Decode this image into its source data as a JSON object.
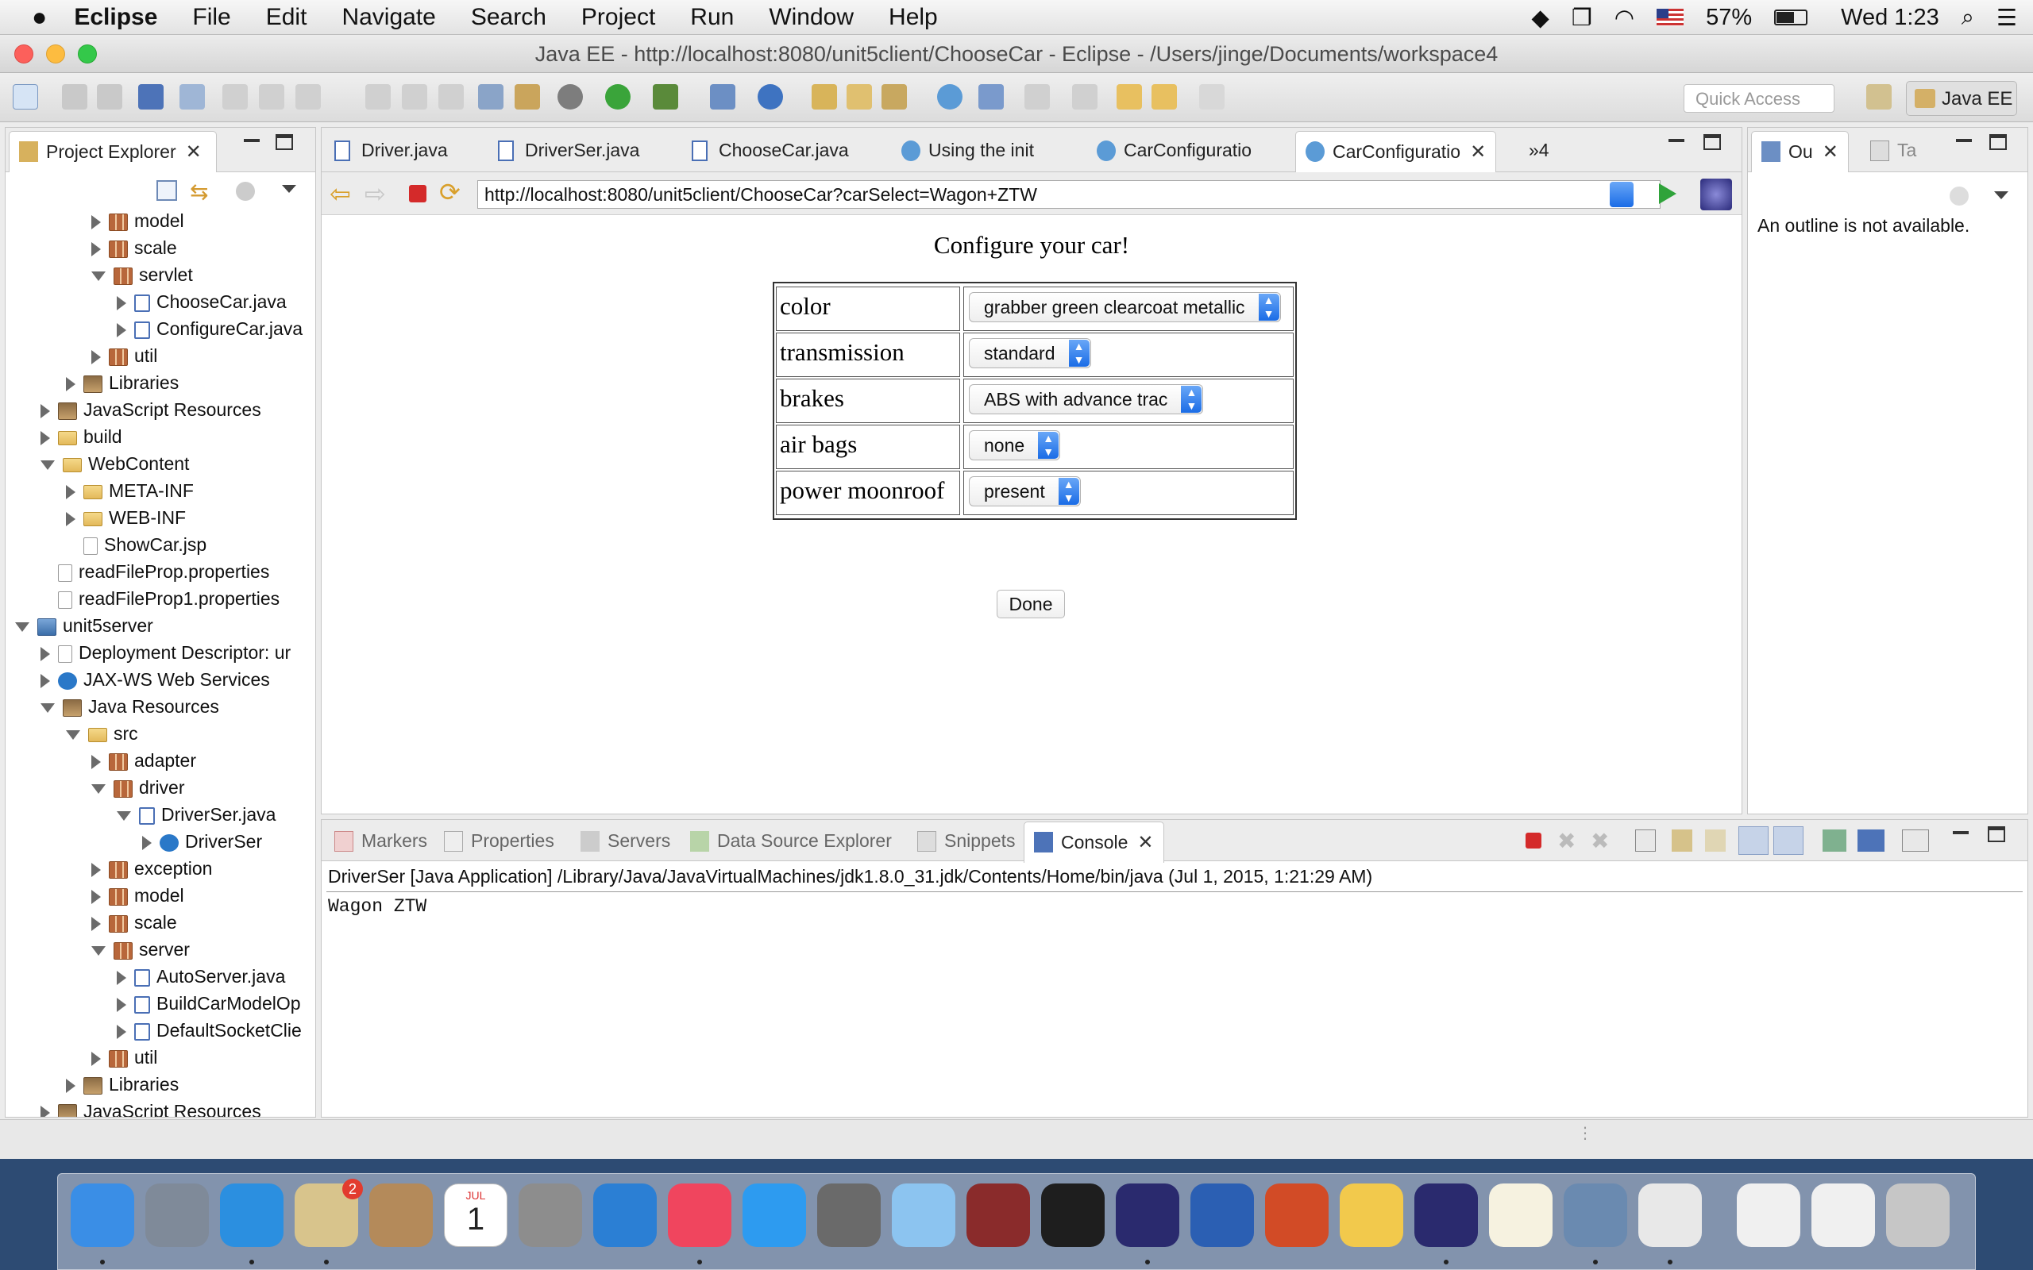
{
  "menubar": {
    "app": "Eclipse",
    "items": [
      "File",
      "Edit",
      "Navigate",
      "Search",
      "Project",
      "Run",
      "Window",
      "Help"
    ],
    "battery": "57%",
    "clock": "Wed 1:23"
  },
  "window": {
    "title": "Java EE - http://localhost:8080/unit5client/ChooseCar - Eclipse - /Users/jinge/Documents/workspace4",
    "quick_access_placeholder": "Quick Access",
    "perspective": "Java EE"
  },
  "project_explorer": {
    "tab_label": "Project Explorer",
    "rows": [
      {
        "depth": 4,
        "twisty": "r",
        "icon": "pkg",
        "label": "model"
      },
      {
        "depth": 4,
        "twisty": "r",
        "icon": "pkg",
        "label": "scale"
      },
      {
        "depth": 4,
        "twisty": "d",
        "icon": "pkg",
        "label": "servlet"
      },
      {
        "depth": 5,
        "twisty": "r",
        "icon": "java",
        "label": "ChooseCar.java"
      },
      {
        "depth": 5,
        "twisty": "r",
        "icon": "java",
        "label": "ConfigureCar.java"
      },
      {
        "depth": 4,
        "twisty": "r",
        "icon": "pkg",
        "label": "util"
      },
      {
        "depth": 3,
        "twisty": "r",
        "icon": "lib",
        "label": "Libraries"
      },
      {
        "depth": 2,
        "twisty": "r",
        "icon": "lib",
        "label": "JavaScript Resources"
      },
      {
        "depth": 2,
        "twisty": "r",
        "icon": "folder",
        "label": "build"
      },
      {
        "depth": 2,
        "twisty": "d",
        "icon": "folder",
        "label": "WebContent"
      },
      {
        "depth": 3,
        "twisty": "r",
        "icon": "folder",
        "label": "META-INF"
      },
      {
        "depth": 3,
        "twisty": "r",
        "icon": "folder",
        "label": "WEB-INF"
      },
      {
        "depth": 3,
        "twisty": "n",
        "icon": "file",
        "label": "ShowCar.jsp"
      },
      {
        "depth": 2,
        "twisty": "n",
        "icon": "file",
        "label": "readFileProp.properties"
      },
      {
        "depth": 2,
        "twisty": "n",
        "icon": "file",
        "label": "readFileProp1.properties"
      },
      {
        "depth": 1,
        "twisty": "d",
        "icon": "proj",
        "label": "unit5server"
      },
      {
        "depth": 2,
        "twisty": "r",
        "icon": "file",
        "label": "Deployment Descriptor: ur"
      },
      {
        "depth": 2,
        "twisty": "r",
        "icon": "ws",
        "label": "JAX-WS Web Services"
      },
      {
        "depth": 2,
        "twisty": "d",
        "icon": "lib",
        "label": "Java Resources"
      },
      {
        "depth": 3,
        "twisty": "d",
        "icon": "folder",
        "label": "src"
      },
      {
        "depth": 4,
        "twisty": "r",
        "icon": "pkg",
        "label": "adapter"
      },
      {
        "depth": 4,
        "twisty": "d",
        "icon": "pkg",
        "label": "driver"
      },
      {
        "depth": 5,
        "twisty": "d",
        "icon": "java",
        "label": "DriverSer.java"
      },
      {
        "depth": 6,
        "twisty": "r",
        "icon": "ws",
        "label": "DriverSer"
      },
      {
        "depth": 4,
        "twisty": "r",
        "icon": "pkg",
        "label": "exception"
      },
      {
        "depth": 4,
        "twisty": "r",
        "icon": "pkg",
        "label": "model"
      },
      {
        "depth": 4,
        "twisty": "r",
        "icon": "pkg",
        "label": "scale"
      },
      {
        "depth": 4,
        "twisty": "d",
        "icon": "pkg",
        "label": "server"
      },
      {
        "depth": 5,
        "twisty": "r",
        "icon": "java",
        "label": "AutoServer.java"
      },
      {
        "depth": 5,
        "twisty": "r",
        "icon": "java",
        "label": "BuildCarModelOp"
      },
      {
        "depth": 5,
        "twisty": "r",
        "icon": "java",
        "label": "DefaultSocketClie"
      },
      {
        "depth": 4,
        "twisty": "r",
        "icon": "pkg",
        "label": "util"
      },
      {
        "depth": 3,
        "twisty": "r",
        "icon": "lib",
        "label": "Libraries"
      },
      {
        "depth": 2,
        "twisty": "r",
        "icon": "lib",
        "label": "JavaScript Resources"
      }
    ]
  },
  "editor": {
    "tabs": [
      "Driver.java",
      "DriverSer.java",
      "ChooseCar.java",
      "Using the init",
      "CarConfiguratio",
      "CarConfiguratio"
    ],
    "overflow": "»4",
    "url": "http://localhost:8080/unit5client/ChooseCar?carSelect=Wagon+ZTW",
    "page": {
      "title": "Configure your car!",
      "options": [
        {
          "label": "color",
          "value": "grabber green clearcoat metallic"
        },
        {
          "label": "transmission",
          "value": "standard"
        },
        {
          "label": "brakes",
          "value": "ABS with advance trac"
        },
        {
          "label": "air bags",
          "value": "none"
        },
        {
          "label": "power moonroof",
          "value": "present"
        }
      ],
      "done": "Done"
    }
  },
  "outline": {
    "tab1": "Ou",
    "tab2": "Ta",
    "message": "An outline is not available."
  },
  "bottom": {
    "tabs": [
      "Markers",
      "Properties",
      "Servers",
      "Data Source Explorer",
      "Snippets",
      "Console"
    ],
    "console_header": "DriverSer [Java Application] /Library/Java/JavaVirtualMachines/jdk1.8.0_31.jdk/Contents/Home/bin/java (Jul 1, 2015, 1:21:29 AM)",
    "console_output": "Wagon ZTW"
  },
  "dock": {
    "items": [
      "finder-icon",
      "launchpad-icon",
      "safari-icon",
      "mail-icon",
      "contacts-icon",
      "calendar-icon",
      "calculator-icon",
      "keynote-icon",
      "itunes-icon",
      "app-store-icon",
      "system-preferences-icon",
      "preview-icon",
      "dictionary-icon",
      "terminal-icon",
      "eclipse-icon",
      "word-icon",
      "powerpoint-icon",
      "photos-icon",
      "eclipse-icon",
      "textedit-icon",
      "image-capture-icon",
      "java-icon",
      "document-icon",
      "document-icon",
      "trash-icon"
    ],
    "mail_badge": "2",
    "calendar_month": "JUL",
    "calendar_day": "1"
  }
}
